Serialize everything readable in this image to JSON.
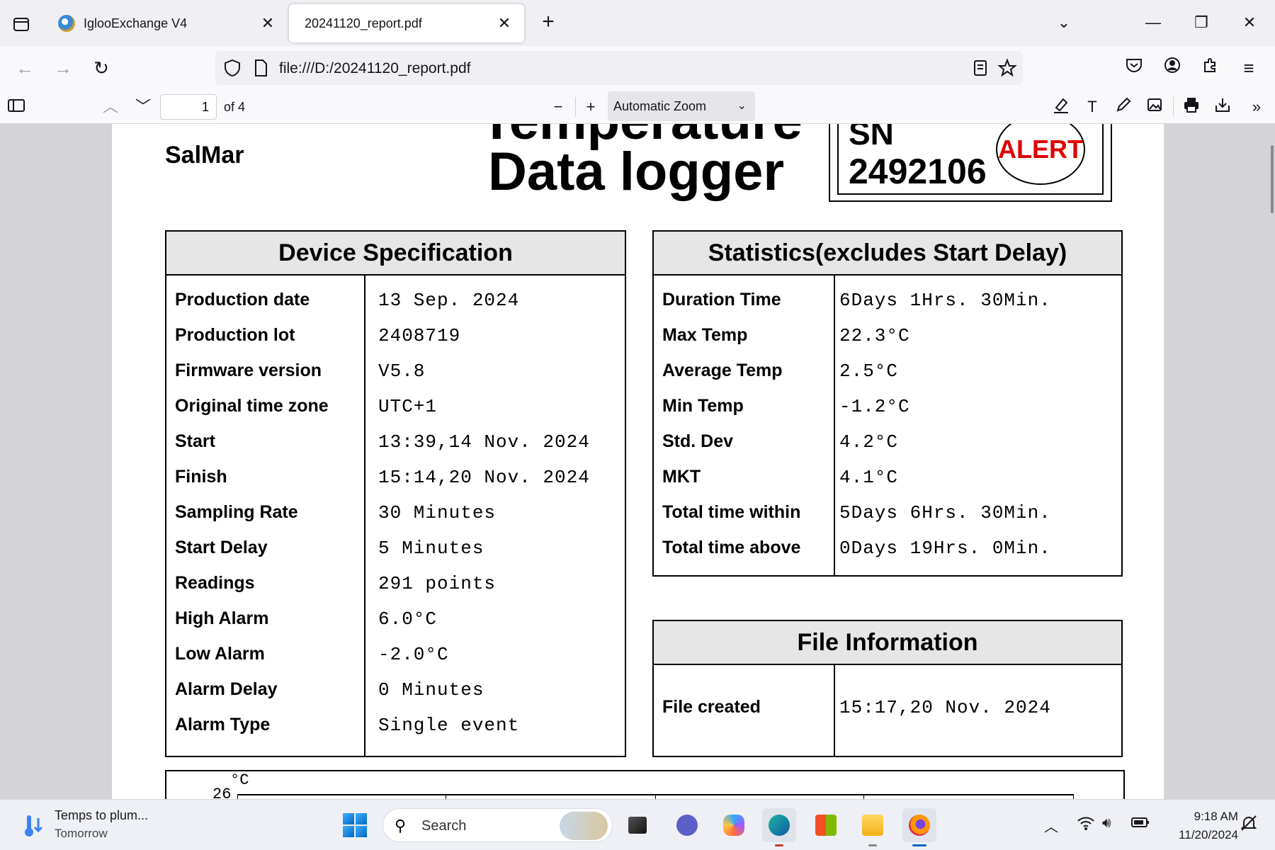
{
  "browser": {
    "tabs": [
      {
        "title": "IglooExchange V4",
        "close": "✕"
      },
      {
        "title": "20241120_report.pdf",
        "close": "✕"
      }
    ],
    "new_tab": "+",
    "url": "file:///D:/20241120_report.pdf"
  },
  "pdf_toolbar": {
    "page_number": "1",
    "page_count_label": "of 4",
    "zoom": "Automatic Zoom"
  },
  "report": {
    "company": "SalMar",
    "title_line1": "Temperature",
    "title_line2": "Data logger",
    "sn_label": "SN",
    "sn_value": "2492106",
    "alert_label": "ALERT",
    "device_spec": {
      "heading": "Device Specification",
      "rows": [
        {
          "key": "Production date",
          "value": "13 Sep. 2024"
        },
        {
          "key": "Production lot",
          "value": "2408719"
        },
        {
          "key": "Firmware version",
          "value": "V5.8"
        },
        {
          "key": "Original time zone",
          "value": "UTC+1"
        },
        {
          "key": "Start",
          "value": "13:39,14 Nov. 2024"
        },
        {
          "key": "Finish",
          "value": "15:14,20 Nov. 2024"
        },
        {
          "key": "Sampling Rate",
          "value": "30 Minutes"
        },
        {
          "key": "Start Delay",
          "value": "5 Minutes"
        },
        {
          "key": "Readings",
          "value": "291 points"
        },
        {
          "key": "High Alarm",
          "value": "6.0°C"
        },
        {
          "key": "Low Alarm",
          "value": "-2.0°C"
        },
        {
          "key": "Alarm Delay",
          "value": "0 Minutes"
        },
        {
          "key": "Alarm Type",
          "value": "Single event"
        }
      ]
    },
    "statistics": {
      "heading": "Statistics(excludes Start Delay)",
      "rows": [
        {
          "key": "Duration Time",
          "value": "6Days 1Hrs. 30Min."
        },
        {
          "key": "Max Temp",
          "value": "22.3°C"
        },
        {
          "key": "Average Temp",
          "value": "2.5°C"
        },
        {
          "key": "Min Temp",
          "value": "-1.2°C"
        },
        {
          "key": "Std. Dev",
          "value": "4.2°C"
        },
        {
          "key": "MKT",
          "value": "4.1°C"
        },
        {
          "key": "Total time within",
          "value": "5Days 6Hrs. 30Min."
        },
        {
          "key": "Total time above",
          "value": "0Days 19Hrs. 0Min."
        }
      ]
    },
    "file_info": {
      "heading": "File Information",
      "rows": [
        {
          "key": "File created",
          "value": "15:17,20 Nov. 2024"
        }
      ]
    },
    "chart": {
      "unit": "°C",
      "top_tick": "26"
    }
  },
  "taskbar": {
    "weather_title": "Temps to plum...",
    "weather_sub": "Tomorrow",
    "search_placeholder": "Search",
    "time": "9:18 AM",
    "date": "11/20/2024"
  }
}
